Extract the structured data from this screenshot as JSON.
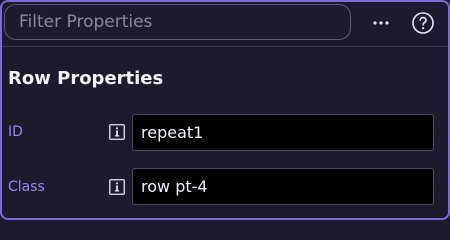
{
  "toolbar": {
    "filter_placeholder": "Filter Properties",
    "filter_value": "",
    "more_icon": "more-horizontal-icon",
    "help_icon": "help-circle-icon"
  },
  "section": {
    "title": "Row Properties"
  },
  "properties": [
    {
      "label": "ID",
      "value": "repeat1",
      "info_icon": "info-icon"
    },
    {
      "label": "Class",
      "value": "row pt-4",
      "info_icon": "info-icon"
    }
  ],
  "colors": {
    "accent": "#9b86f5",
    "border_accent": "#7d6ad8",
    "background": "#1e1a2e",
    "input_background": "#000000"
  }
}
